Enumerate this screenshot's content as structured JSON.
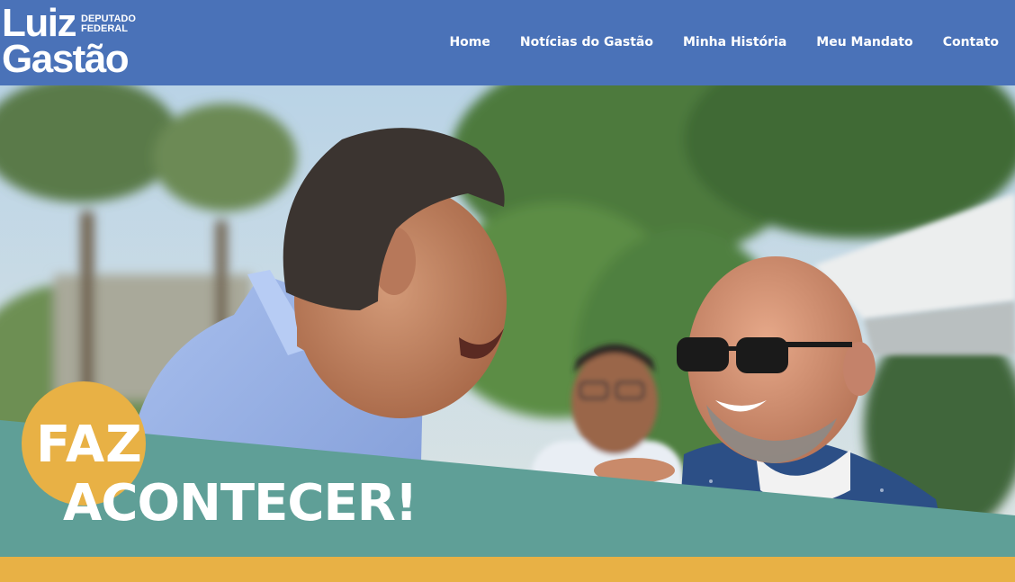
{
  "logo": {
    "name_line1": "Luiz",
    "name_line2": "Gastão",
    "role_line1": "DEPUTADO",
    "role_line2": "FEDERAL"
  },
  "nav": {
    "items": [
      {
        "label": "Home"
      },
      {
        "label": "Notícias do Gastão"
      },
      {
        "label": "Minha História"
      },
      {
        "label": "Meu Mandato"
      },
      {
        "label": "Contato"
      }
    ]
  },
  "hero": {
    "slogan_line1": "FAZ",
    "slogan_line2": "ACONTECER!"
  },
  "colors": {
    "header_blue": "#4a72b8",
    "banner_teal": "#5f9f97",
    "accent_yellow": "#e8b145",
    "text_white": "#ffffff"
  }
}
